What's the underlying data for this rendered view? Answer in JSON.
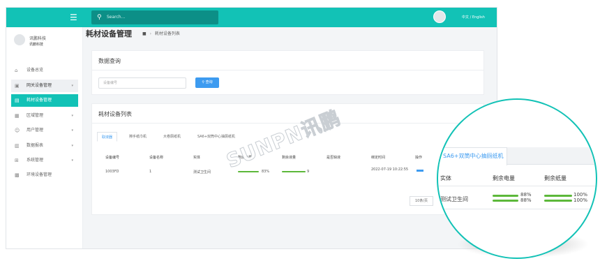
{
  "topbar": {
    "search_placeholder": "Search...",
    "lang": "中文 / English"
  },
  "sidebar": {
    "user_name": "讯鹏科技",
    "user_sub": "讯鹏科技",
    "items": [
      {
        "label": "设备总览",
        "icon": "home-icon"
      },
      {
        "label": "网关设备管理",
        "icon": "device-icon",
        "chevron": "▾"
      },
      {
        "label": "耗材设备管理",
        "icon": "box-icon"
      },
      {
        "label": "区域管理",
        "icon": "area-icon",
        "chevron": "▾"
      },
      {
        "label": "用户管理",
        "icon": "user-icon",
        "chevron": "▾"
      },
      {
        "label": "数据报表",
        "icon": "chart-icon",
        "chevron": "▾"
      },
      {
        "label": "系统管理",
        "icon": "grid-icon",
        "chevron": "▾"
      },
      {
        "label": "环境设备管理",
        "icon": "env-icon"
      }
    ]
  },
  "page": {
    "title": "耗材设备管理",
    "breadcrumb": "耗材设备列表",
    "query_title": "数据查询",
    "input_placeholder": "设备编号",
    "query_button": "查询",
    "list_title": "耗材设备列表",
    "tabs": [
      "取液器",
      "擦手纸巾机",
      "大卷厕纸机",
      "SA6+双筒中心抽厕纸机"
    ],
    "columns": [
      "设备编号",
      "设备名称",
      "实体",
      "剩余电量",
      "剩余液量",
      "是否缺液",
      "绑定时间",
      "操作"
    ],
    "row": {
      "id": "1003FD",
      "name": "1",
      "entity": "测试卫生间",
      "battery": "83%",
      "liquid": "9",
      "bind_time": "2022-07-19 10:22:55"
    },
    "pager": "10条/页",
    "watermark": "SUNPN讯鹏"
  },
  "zoom": {
    "tab": "SA6+双筒中心抽厕纸机",
    "columns": [
      "实体",
      "剩余电量",
      "剩余纸量"
    ],
    "entity": "测试卫生间",
    "battery": [
      "88%",
      "88%"
    ],
    "paper": [
      "100%",
      "100%"
    ]
  },
  "colors": {
    "accent": "#12c2b6",
    "primary": "#3d9bf0",
    "progress": "#5cb83a"
  }
}
